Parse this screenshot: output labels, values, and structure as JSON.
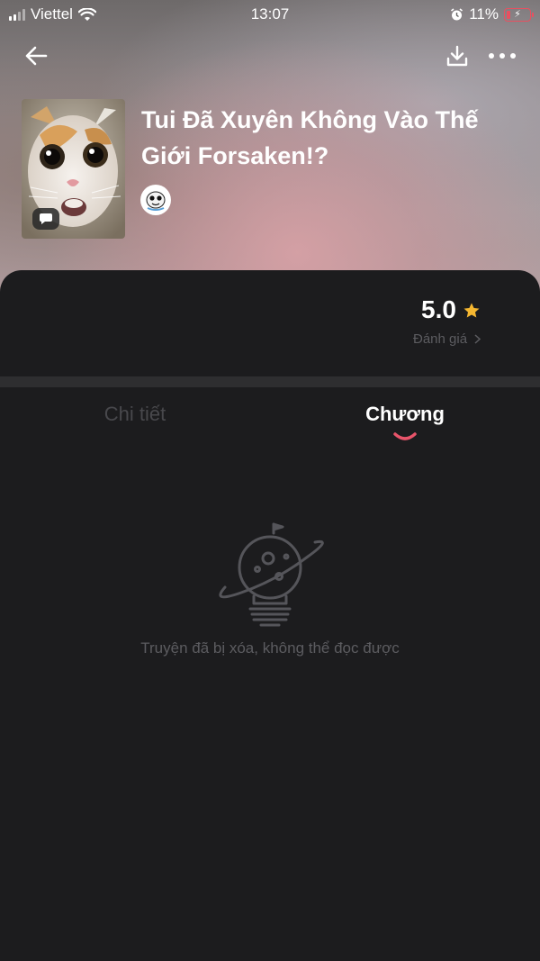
{
  "status_bar": {
    "carrier": "Viettel",
    "time": "13:07",
    "battery": "11%"
  },
  "book": {
    "title": "Tui Đã Xuyên Không Vào Thế Giới Forsaken!?",
    "rating": "5.0",
    "rating_label": "Đánh giá"
  },
  "tabs": [
    {
      "label": "Chi tiết",
      "active": false
    },
    {
      "label": "Chương",
      "active": true
    }
  ],
  "empty_state": {
    "message": "Truyện đã bị xóa, không thể đọc được"
  },
  "colors": {
    "accent": "#e8546a",
    "star": "#f5b731",
    "background": "#1c1c1e"
  },
  "icons": [
    "back-arrow-icon",
    "download-icon",
    "more-icon",
    "comment-icon",
    "star-icon",
    "chevron-right-icon",
    "planet-lightbulb-icon"
  ]
}
